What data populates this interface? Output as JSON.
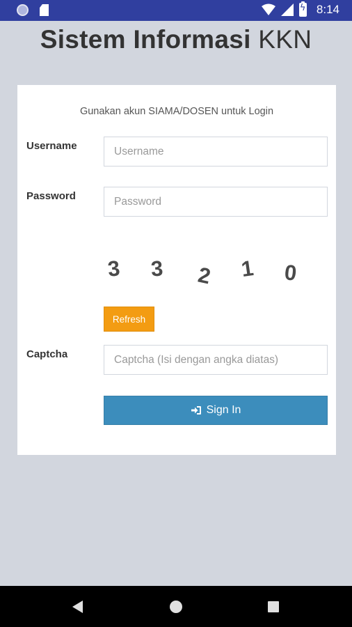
{
  "status_bar": {
    "time": "8:14",
    "icons": [
      "notification-dot-icon",
      "sd-card-icon",
      "wifi-icon",
      "cell-signal-icon",
      "battery-charging-icon"
    ]
  },
  "header": {
    "title_bold": "Sistem Informasi",
    "title_light": "KKN"
  },
  "login": {
    "message": "Gunakan akun SIAMA/DOSEN untuk Login",
    "username_label": "Username",
    "username_placeholder": "Username",
    "password_label": "Password",
    "password_placeholder": "Password",
    "captcha_digits": [
      "3",
      "3",
      "2",
      "1",
      "0"
    ],
    "refresh_label": "Refresh",
    "captcha_label": "Captcha",
    "captcha_placeholder": "Captcha (Isi dengan angka diatas)",
    "signin_label": "Sign In",
    "signin_icon": "sign-in-icon"
  },
  "colors": {
    "status_bar": "#303f9f",
    "background": "#d2d6de",
    "refresh_button": "#f39c12",
    "signin_button": "#3c8dbc"
  },
  "nav_bar": {
    "icons": [
      "back-icon",
      "home-icon",
      "recents-icon"
    ]
  }
}
